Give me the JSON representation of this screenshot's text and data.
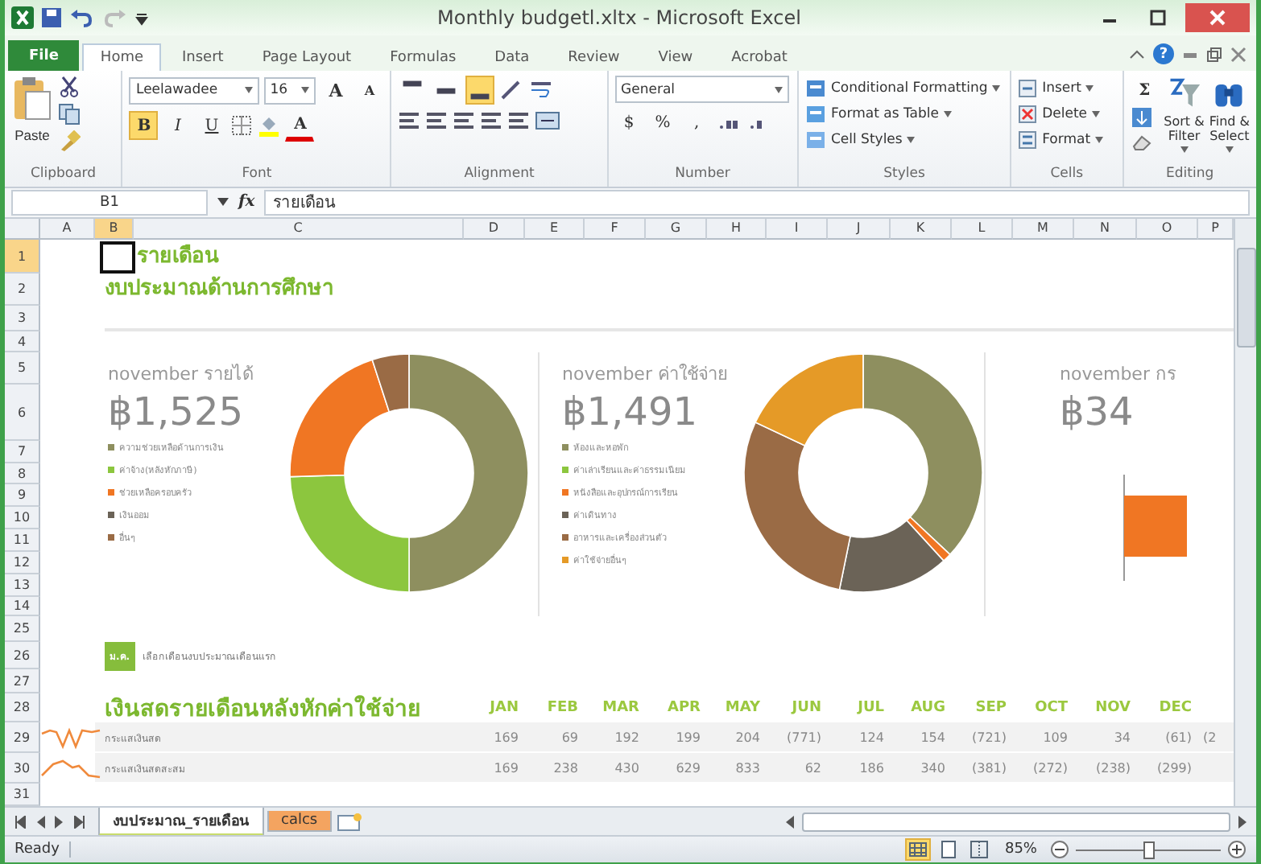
{
  "window": {
    "title": "Monthly budgetl.xltx - Microsoft Excel"
  },
  "tabs": [
    {
      "label": "File",
      "kind": "file",
      "selected": false
    },
    {
      "label": "Home",
      "kind": "tab",
      "selected": true
    },
    {
      "label": "Insert",
      "kind": "tab",
      "selected": false
    },
    {
      "label": "Page Layout",
      "kind": "tab",
      "selected": false
    },
    {
      "label": "Formulas",
      "kind": "tab",
      "selected": false
    },
    {
      "label": "Data",
      "kind": "tab",
      "selected": false
    },
    {
      "label": "Review",
      "kind": "tab",
      "selected": false
    },
    {
      "label": "View",
      "kind": "tab",
      "selected": false
    },
    {
      "label": "Acrobat",
      "kind": "tab",
      "selected": false
    }
  ],
  "help": "?",
  "ribbon": {
    "clipboard": {
      "label": "Clipboard",
      "paste": "Paste"
    },
    "font": {
      "label": "Font",
      "family": "Leelawadee",
      "size": "16",
      "grow": "A",
      "shrink": "A",
      "styles": [
        {
          "label": "B",
          "kind": "bold",
          "selected": true
        },
        {
          "label": "I",
          "kind": "italic",
          "selected": false
        },
        {
          "label": "U",
          "kind": "underline",
          "selected": false
        }
      ],
      "font_color": "A"
    },
    "alignment": {
      "label": "Alignment",
      "vertical": [
        {
          "kind": "top",
          "selected": false
        },
        {
          "kind": "middle",
          "selected": false
        },
        {
          "kind": "bottom",
          "selected": true
        }
      ]
    },
    "number": {
      "label": "Number",
      "format": "General",
      "currency": "$",
      "percent": "%",
      "comma": ","
    },
    "styles": {
      "label": "Styles",
      "items": [
        "Conditional Formatting",
        "Format as Table",
        "Cell Styles"
      ]
    },
    "cells": {
      "label": "Cells",
      "items": [
        "Insert",
        "Delete",
        "Format"
      ]
    },
    "editing": {
      "label": "Editing",
      "sum": "Σ",
      "items": [
        {
          "line1": "Sort &",
          "line2": "Filter"
        },
        {
          "line1": "Find &",
          "line2": "Select"
        }
      ]
    }
  },
  "formula_bar": {
    "name_box": "B1",
    "fx": "fx",
    "formula": "รายเดือน"
  },
  "columns": [
    {
      "label": "A",
      "selected": false
    },
    {
      "label": "B",
      "selected": true
    },
    {
      "label": "C",
      "selected": false
    },
    {
      "label": "D",
      "selected": false
    },
    {
      "label": "E",
      "selected": false
    },
    {
      "label": "F",
      "selected": false
    },
    {
      "label": "G",
      "selected": false
    },
    {
      "label": "H",
      "selected": false
    },
    {
      "label": "I",
      "selected": false
    },
    {
      "label": "J",
      "selected": false
    },
    {
      "label": "K",
      "selected": false
    },
    {
      "label": "L",
      "selected": false
    },
    {
      "label": "M",
      "selected": false
    },
    {
      "label": "N",
      "selected": false
    },
    {
      "label": "O",
      "selected": false
    },
    {
      "label": "P",
      "selected": false
    }
  ],
  "rows": [
    {
      "label": "1",
      "selected": true
    },
    {
      "label": "2",
      "selected": false
    },
    {
      "label": "3",
      "selected": false
    },
    {
      "label": "4",
      "selected": false
    },
    {
      "label": "5",
      "selected": false
    },
    {
      "label": "6",
      "selected": false
    },
    {
      "label": "7",
      "selected": false
    },
    {
      "label": "8",
      "selected": false
    },
    {
      "label": "9",
      "selected": false
    },
    {
      "label": "10",
      "selected": false
    },
    {
      "label": "11",
      "selected": false
    },
    {
      "label": "12",
      "selected": false
    },
    {
      "label": "13",
      "selected": false
    },
    {
      "label": "14",
      "selected": false
    },
    {
      "label": "25",
      "selected": false
    },
    {
      "label": "26",
      "selected": false
    },
    {
      "label": "27",
      "selected": false
    },
    {
      "label": "28",
      "selected": false
    },
    {
      "label": "29",
      "selected": false
    },
    {
      "label": "30",
      "selected": false
    },
    {
      "label": "31",
      "selected": false
    }
  ],
  "sheet": {
    "title": "รายเดือน",
    "subtitle": "งบประมาณด้านการศึกษา",
    "panels": [
      {
        "kind": "donut",
        "heading": "november รายได้",
        "amount": "฿1,525",
        "legend": [
          {
            "label": "ความช่วยเหลือด้านการเงิน",
            "color": "#8e8f5f"
          },
          {
            "label": "ค่าจ้าง(หลังหักภาษี)",
            "color": "#8cc63e"
          },
          {
            "label": "ช่วยเหลือครอบครัว",
            "color": "#f07623"
          },
          {
            "label": "เงินออม",
            "color": "#6b6357"
          },
          {
            "label": "อื่นๆ",
            "color": "#9a6b45"
          }
        ]
      },
      {
        "kind": "donut",
        "heading": "november ค่าใช้จ่าย",
        "amount": "฿1,491",
        "legend": [
          {
            "label": "ห้องและหอพัก",
            "color": "#8e8f5f"
          },
          {
            "label": "ค่าเล่าเรียนและค่าธรรมเนียม",
            "color": "#8cc63e"
          },
          {
            "label": "หนังสือและอุปกรณ์การเรียน",
            "color": "#f07623"
          },
          {
            "label": "ค่าเดินทาง",
            "color": "#6b6357"
          },
          {
            "label": "อาหารและเครื่องส่วนตัว",
            "color": "#9a6b45"
          },
          {
            "label": "ค่าใช้จ่ายอื่นๆ",
            "color": "#e59a27"
          }
        ]
      },
      {
        "kind": "bar",
        "heading": "november กร",
        "amount": "฿34"
      }
    ],
    "month_badge": "ม.ค.",
    "month_note": "เลือกเดือนงบประมาณเดือนแรก",
    "cashflow": {
      "title": "เงินสดรายเดือนหลังหักค่าใช้จ่าย",
      "months": [
        "JAN",
        "FEB",
        "MAR",
        "APR",
        "MAY",
        "JUN",
        "JUL",
        "AUG",
        "SEP",
        "OCT",
        "NOV",
        "DEC"
      ],
      "rows": [
        {
          "label": "กระแสเงินสด",
          "values": [
            "169",
            "69",
            "192",
            "199",
            "204",
            "(771)",
            "124",
            "154",
            "(721)",
            "109",
            "34",
            "(61)",
            "(2"
          ]
        },
        {
          "label": "กระแสเงินสดสะสม",
          "values": [
            "169",
            "238",
            "430",
            "629",
            "833",
            "62",
            "186",
            "340",
            "(381)",
            "(272)",
            "(238)",
            "(299)"
          ]
        }
      ]
    }
  },
  "sheet_tabs": [
    {
      "label": "งบประมาณ_รายเดือน",
      "selected": true,
      "color": "#c9dc6c"
    },
    {
      "label": "calcs",
      "selected": false,
      "color": "#f4a460"
    }
  ],
  "status_bar": {
    "text": "Ready",
    "views": [
      {
        "kind": "normal",
        "selected": true
      },
      {
        "kind": "page_layout",
        "selected": false
      },
      {
        "kind": "page_break",
        "selected": false
      }
    ],
    "zoom": "85%",
    "zoom_slider": {
      "level": 0.5
    }
  }
}
